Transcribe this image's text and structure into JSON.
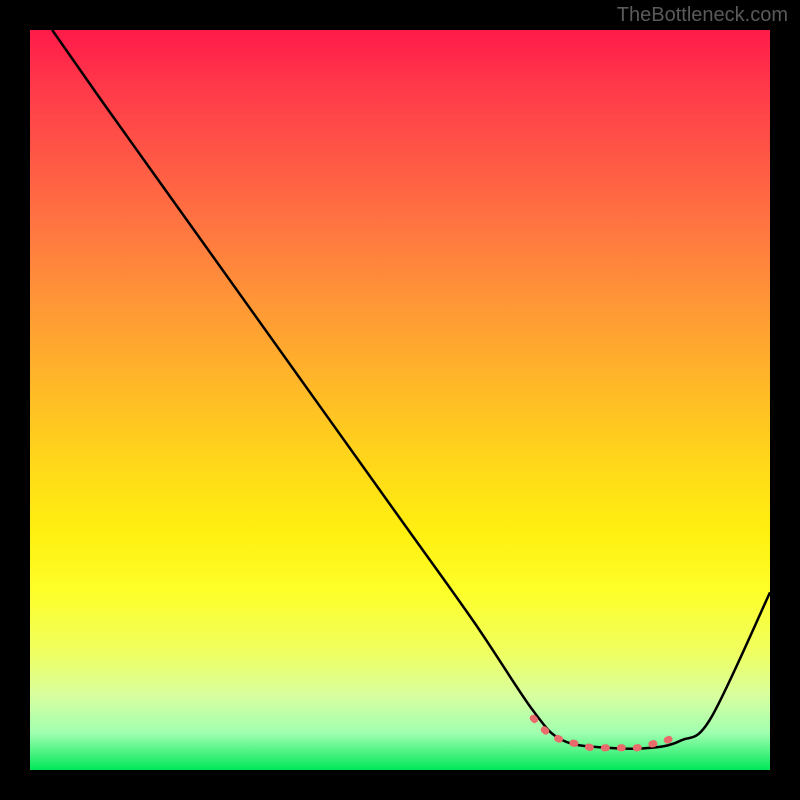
{
  "watermark": "TheBottleneck.com",
  "chart_data": {
    "type": "line",
    "title": "",
    "xlabel": "",
    "ylabel": "",
    "xlim": [
      0,
      100
    ],
    "ylim": [
      0,
      100
    ],
    "series": [
      {
        "name": "bottleneck-curve",
        "color": "#000000",
        "x": [
          3,
          10,
          20,
          30,
          40,
          50,
          60,
          68,
          72,
          78,
          84,
          88,
          92,
          100
        ],
        "y": [
          100,
          90,
          76,
          62,
          48,
          34,
          20,
          8,
          4,
          3,
          3,
          4,
          7,
          24
        ]
      },
      {
        "name": "optimal-range-marker",
        "color": "#e96b6b",
        "x": [
          68,
          70,
          72,
          74,
          76,
          78,
          80,
          82,
          84,
          86,
          88
        ],
        "y": [
          7,
          5,
          4,
          3.5,
          3,
          3,
          3,
          3,
          3.5,
          4,
          5
        ]
      }
    ],
    "gradient_stops": [
      {
        "pos": 0,
        "color": "#ff1a4a"
      },
      {
        "pos": 50,
        "color": "#ffd61a"
      },
      {
        "pos": 100,
        "color": "#00e858"
      }
    ]
  }
}
